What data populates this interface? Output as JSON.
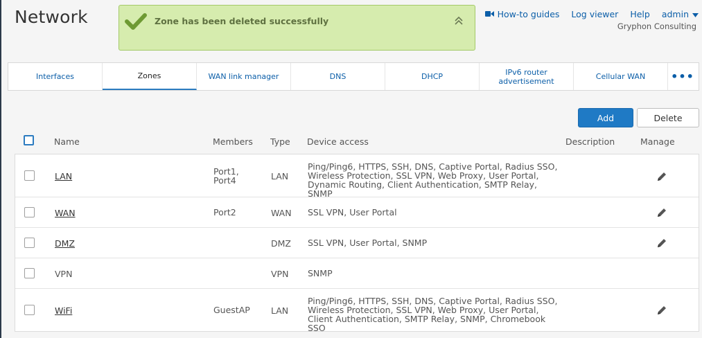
{
  "page": {
    "title": "Network"
  },
  "alert": {
    "message": "Zone has been deleted successfully"
  },
  "top_links": {
    "guides": "How-to guides",
    "log_viewer": "Log viewer",
    "help": "Help",
    "user": "admin",
    "company": "Gryphon Consulting"
  },
  "tabs": [
    {
      "label": "Interfaces"
    },
    {
      "label": "Zones",
      "active": true
    },
    {
      "label": "WAN link manager"
    },
    {
      "label": "DNS"
    },
    {
      "label": "DHCP"
    },
    {
      "label": "IPv6 router advertisement"
    },
    {
      "label": "Cellular WAN"
    },
    {
      "label": "•••"
    }
  ],
  "buttons": {
    "add": "Add",
    "delete": "Delete"
  },
  "table": {
    "headers": {
      "name": "Name",
      "members": "Members",
      "type": "Type",
      "access": "Device access",
      "description": "Description",
      "manage": "Manage"
    },
    "rows": [
      {
        "name": "LAN",
        "members": "Port1,\nPort4",
        "type": "LAN",
        "access": "Ping/Ping6, HTTPS, SSH, DNS, Captive Portal, Radius SSO, Wireless Protection, SSL VPN, Web Proxy, User Portal, Dynamic Routing, Client Authentication, SMTP Relay, SNMP",
        "link": true,
        "editable": true
      },
      {
        "name": "WAN",
        "members": "Port2",
        "type": "WAN",
        "access": "SSL VPN, User Portal",
        "link": true,
        "editable": true
      },
      {
        "name": "DMZ",
        "members": "",
        "type": "DMZ",
        "access": "SSL VPN, User Portal, SNMP",
        "link": true,
        "editable": true
      },
      {
        "name": "VPN",
        "members": "",
        "type": "VPN",
        "access": "SNMP",
        "link": false,
        "editable": false
      },
      {
        "name": "WiFi",
        "members": "GuestAP",
        "type": "LAN",
        "access": "Ping/Ping6, HTTPS, SSH, DNS, Captive Portal, Radius SSO, Wireless Protection, SSL VPN, Web Proxy, User Portal, Client Authentication, SMTP Relay, SNMP, Chromebook SSO",
        "link": true,
        "editable": true
      }
    ]
  },
  "colors": {
    "accent": "#1f7ac5",
    "alert_bg": "#d6ecae",
    "alert_text": "#5f7141",
    "link": "#0b5ea8"
  }
}
